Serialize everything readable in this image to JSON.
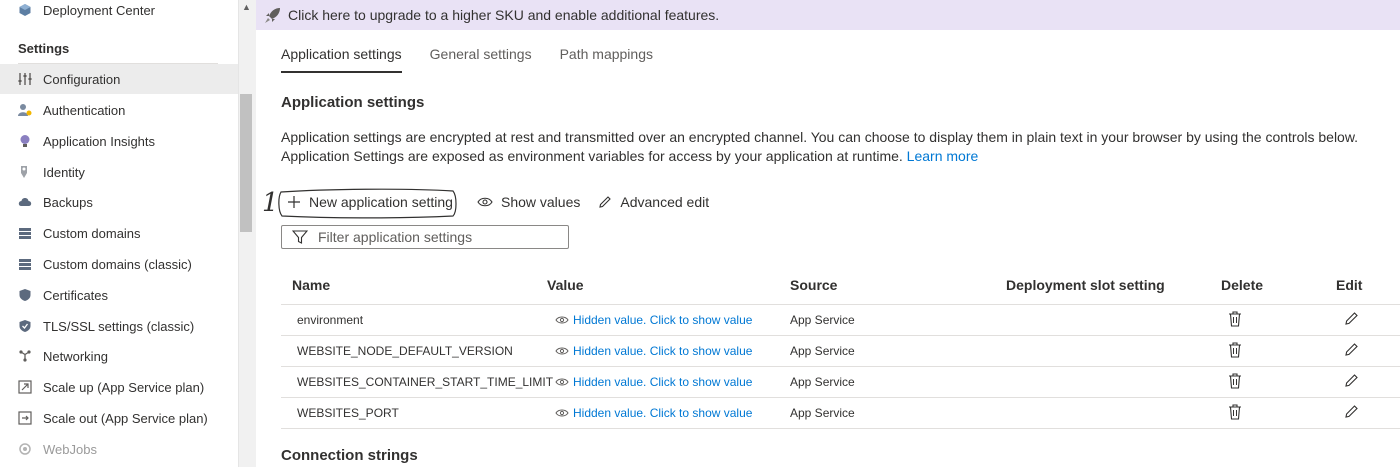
{
  "sidebar": {
    "items_top": [
      {
        "label": "Deployment Center",
        "icon": "deployment-center-icon"
      }
    ],
    "section_title": "Settings",
    "items": [
      {
        "label": "Configuration",
        "icon": "configuration-icon",
        "selected": true
      },
      {
        "label": "Authentication",
        "icon": "authentication-icon"
      },
      {
        "label": "Application Insights",
        "icon": "application-insights-icon"
      },
      {
        "label": "Identity",
        "icon": "identity-icon"
      },
      {
        "label": "Backups",
        "icon": "backups-icon"
      },
      {
        "label": "Custom domains",
        "icon": "custom-domains-icon"
      },
      {
        "label": "Custom domains (classic)",
        "icon": "custom-domains-classic-icon"
      },
      {
        "label": "Certificates",
        "icon": "certificates-icon"
      },
      {
        "label": "TLS/SSL settings (classic)",
        "icon": "tls-ssl-icon"
      },
      {
        "label": "Networking",
        "icon": "networking-icon"
      },
      {
        "label": "Scale up (App Service plan)",
        "icon": "scale-up-icon"
      },
      {
        "label": "Scale out (App Service plan)",
        "icon": "scale-out-icon"
      },
      {
        "label": "WebJobs",
        "icon": "webjobs-icon",
        "dim": true
      }
    ]
  },
  "banner": {
    "text": "Click here to upgrade to a higher SKU and enable additional features.",
    "bg": "#e9e2f5"
  },
  "tabs": [
    "Application settings",
    "General settings",
    "Path mappings"
  ],
  "main": {
    "section_title": "Application settings",
    "description": "Application settings are encrypted at rest and transmitted over an encrypted channel. You can choose to display them in plain text in your browser by using the controls below. Application Settings are exposed as environment variables for access by your application at runtime.",
    "learn_more": "Learn more",
    "toolbar": {
      "new_label": "New application setting",
      "show_values_label": "Show values",
      "advanced_edit_label": "Advanced edit"
    },
    "annotation_number": "1",
    "filter_placeholder": "Filter application settings",
    "table": {
      "headers": {
        "name": "Name",
        "value": "Value",
        "source": "Source",
        "slot": "Deployment slot setting",
        "delete": "Delete",
        "edit": "Edit"
      },
      "rows": [
        {
          "name": "environment",
          "value": "Hidden value. Click to show value",
          "source": "App Service"
        },
        {
          "name": "WEBSITE_NODE_DEFAULT_VERSION",
          "value": "Hidden value. Click to show value",
          "source": "App Service"
        },
        {
          "name": "WEBSITES_CONTAINER_START_TIME_LIMIT",
          "value": "Hidden value. Click to show value",
          "source": "App Service"
        },
        {
          "name": "WEBSITES_PORT",
          "value": "Hidden value. Click to show value",
          "source": "App Service"
        }
      ]
    },
    "connection_strings_title": "Connection strings"
  },
  "colors": {
    "accent": "#0078d4",
    "banner": "#e9e2f5",
    "selected": "#ececec"
  }
}
